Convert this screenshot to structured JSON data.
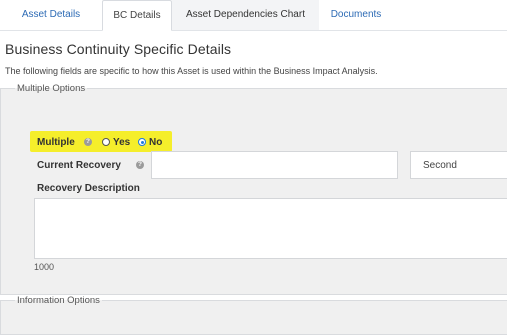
{
  "tabs": [
    {
      "label": "Asset Details"
    },
    {
      "label": "BC Details"
    },
    {
      "label": "Asset Dependencies Chart"
    },
    {
      "label": "Documents"
    }
  ],
  "section": {
    "title": "Business Continuity Specific Details",
    "description": "The following fields are specific to how this Asset is used within the Business Impact Analysis."
  },
  "multiple_options": {
    "legend": "Multiple Options",
    "multiple": {
      "label": "Multiple",
      "help_icon": "question-circle-icon",
      "options": [
        {
          "label": "Yes",
          "checked": false
        },
        {
          "label": "No",
          "checked": true
        }
      ],
      "highlight_color": "#f5ee2b"
    },
    "current_recovery": {
      "label": "Current Recovery",
      "help_icon": "question-circle-icon",
      "value": "",
      "unit_selected": "Second"
    },
    "recovery_description": {
      "label": "Recovery Description",
      "value": "",
      "char_counter": "1000"
    }
  },
  "information_options": {
    "legend": "Information Options"
  },
  "colors": {
    "link": "#2d6bb5",
    "panel_bg": "#f0f0f0",
    "radio_checked": "#1f7ae0"
  }
}
